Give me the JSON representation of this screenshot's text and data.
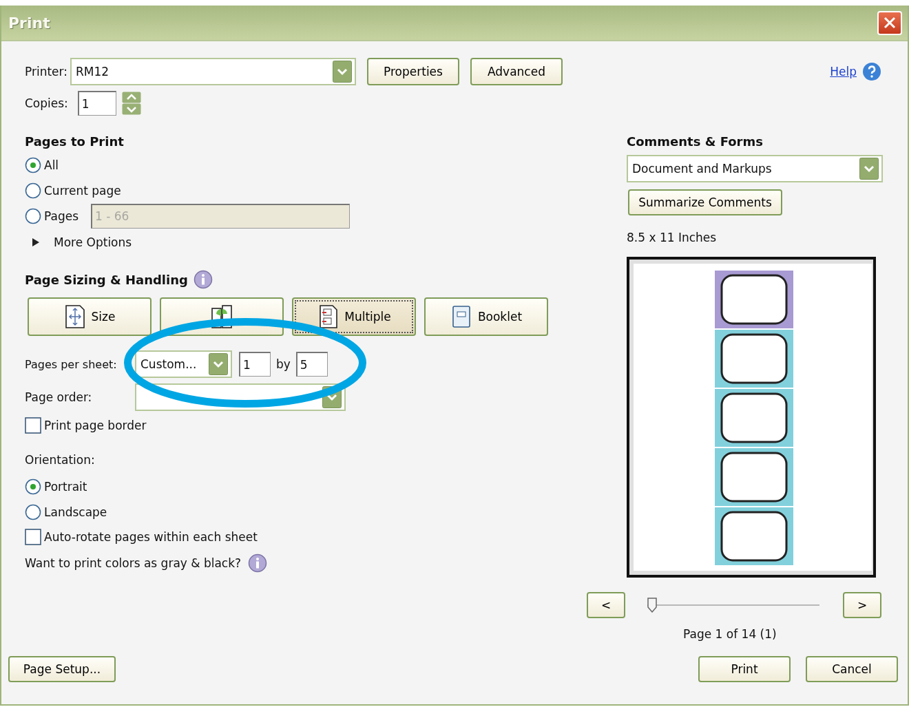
{
  "window": {
    "title": "Print"
  },
  "help": {
    "label": "Help"
  },
  "printer": {
    "label": "Printer:",
    "value": "RM12",
    "buttons": [
      "Properties",
      "Advanced"
    ]
  },
  "copies": {
    "label": "Copies:",
    "value": "1"
  },
  "pages_to_print": {
    "title": "Pages to Print",
    "options": [
      {
        "label": "All",
        "selected": true
      },
      {
        "label": "Current page",
        "selected": false
      },
      {
        "label": "Pages",
        "selected": false,
        "range": "1 - 66"
      }
    ],
    "more_options": "More Options"
  },
  "sizing": {
    "title": "Page Sizing & Handling",
    "modes": [
      {
        "kind": "size",
        "label": "Size",
        "selected": false
      },
      {
        "kind": "poster",
        "selected": false
      },
      {
        "kind": "multiple",
        "label": "Multiple",
        "selected": true
      },
      {
        "kind": "booklet",
        "label": "Booklet",
        "selected": false
      }
    ],
    "pages_per_sheet": {
      "label": "Pages per sheet:",
      "value": "Custom...",
      "columns": "1",
      "by": "by",
      "rows": "5"
    },
    "page_order": {
      "label": "Page order:"
    },
    "print_page_border": {
      "label": "Print page border",
      "checked": false
    },
    "orientation": {
      "label": "Orientation:",
      "options": [
        {
          "label": "Portrait",
          "selected": true
        },
        {
          "label": "Landscape",
          "selected": false
        }
      ]
    },
    "auto_rotate": {
      "label": "Auto-rotate pages within each sheet",
      "checked": false
    },
    "gray_hint": "Want to print colors as gray & black?"
  },
  "comments_forms": {
    "title": "Comments & Forms",
    "value": "Document and Markups",
    "button": "Summarize Comments"
  },
  "preview": {
    "size": "8.5 x 11 Inches",
    "kind": "picture",
    "prev": "<",
    "next": ">",
    "slider": {
      "level": 0
    },
    "page_info": "Page 1 of 14 (1)"
  },
  "footer": {
    "page_setup": "Page Setup...",
    "print": "Print",
    "cancel": "Cancel"
  },
  "annotation": {
    "kind": "ellipse"
  }
}
